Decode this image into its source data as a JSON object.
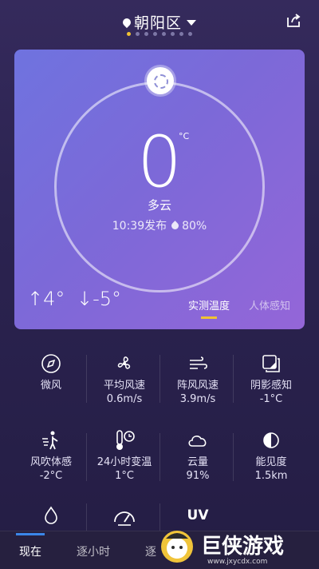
{
  "header": {
    "location": "朝阳区",
    "page_dots": 8,
    "active_dot": 0
  },
  "now": {
    "temperature": "0",
    "unit": "°C",
    "condition": "多云",
    "publish_time": "10:39发布",
    "humidity": "80%",
    "high": "↑4°",
    "low": "↓-5°",
    "tabs": [
      "实测温度",
      "人体感知"
    ]
  },
  "details": [
    {
      "icon": "compass-icon",
      "label": "微风",
      "value": ""
    },
    {
      "icon": "fan-icon",
      "label": "平均风速",
      "value": "0.6m/s"
    },
    {
      "icon": "wind-icon",
      "label": "阵风风速",
      "value": "3.9m/s"
    },
    {
      "icon": "shade-icon",
      "label": "阴影感知",
      "value": "-1°C"
    },
    {
      "icon": "person-wind-icon",
      "label": "风吹体感",
      "value": "-2°C"
    },
    {
      "icon": "thermometer-clock-icon",
      "label": "24小时变温",
      "value": "1°C"
    },
    {
      "icon": "cloud-icon",
      "label": "云量",
      "value": "91%"
    },
    {
      "icon": "visibility-icon",
      "label": "能见度",
      "value": "1.5km"
    },
    {
      "icon": "drop-icon",
      "label": "",
      "value": ""
    },
    {
      "icon": "gauge-icon",
      "label": "",
      "value": ""
    },
    {
      "icon": "uv-icon",
      "label": "UV",
      "value": ""
    }
  ],
  "bottom_tabs": [
    "现在",
    "逐小时",
    "逐"
  ],
  "watermark": {
    "text": "巨侠游戏",
    "url": "www.jxycdx.com"
  }
}
